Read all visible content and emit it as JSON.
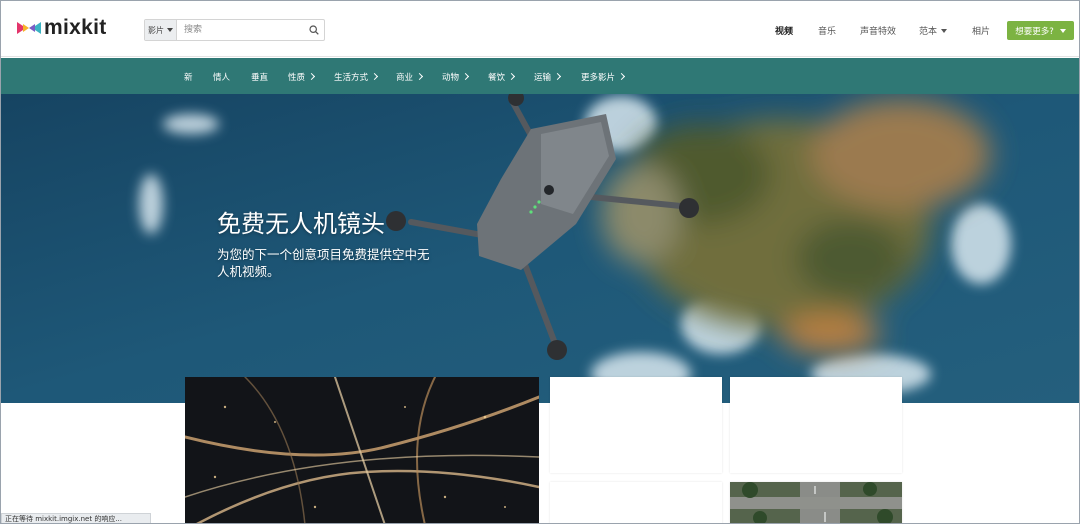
{
  "logo": {
    "text": "mixkit"
  },
  "search": {
    "type_label": "影片",
    "placeholder": "搜索",
    "value": ""
  },
  "top_nav": [
    "视频",
    "音乐",
    "声音特效",
    "范本",
    "相片"
  ],
  "cta": {
    "label": "想要更多?"
  },
  "categories": [
    "新",
    "情人",
    "垂直",
    "性质",
    "生活方式",
    "商业",
    "动物",
    "餐饮",
    "运输",
    "更多影片"
  ],
  "hero": {
    "title": "免费无人机镜头",
    "subtitle": "为您的下一个创意项目免费提供空中无人机视频。"
  },
  "status_bar": {
    "text": "正在等待 mixkit.imgix.net 的响应..."
  },
  "colors": {
    "category_bar": "#2f7875",
    "cta": "#7cb342",
    "hero_sea": "#1d4a6b"
  },
  "icons": [
    "mixkit-logo-icon",
    "search-icon",
    "drone-image"
  ]
}
